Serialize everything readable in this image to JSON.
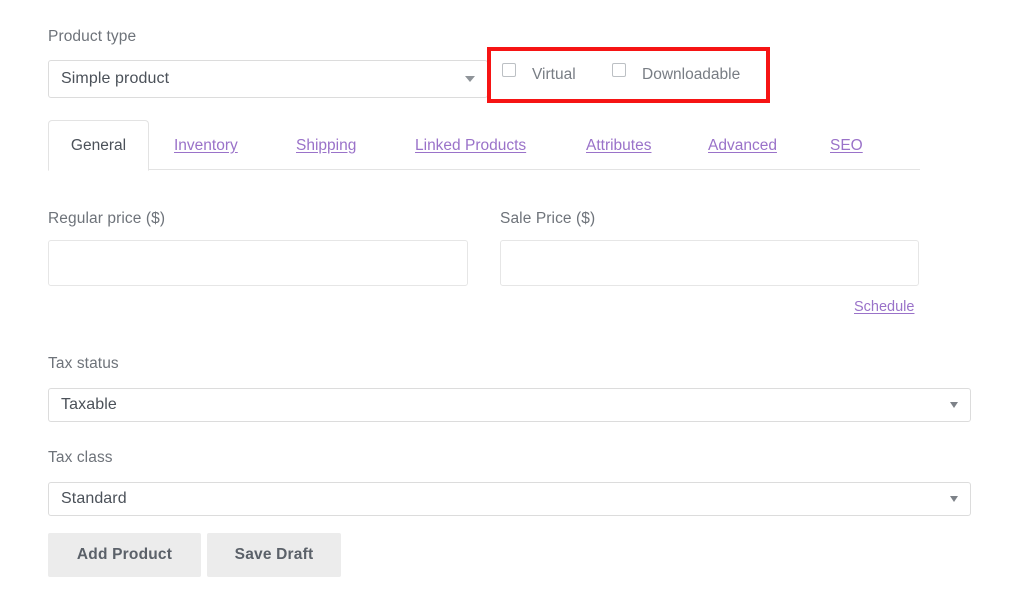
{
  "form": {
    "product_type": {
      "label": "Product type",
      "selected": "Simple product",
      "caret_icon": "chevron-down-icon"
    },
    "checkboxes": [
      {
        "id": "virtual",
        "label": "Virtual",
        "checked": false
      },
      {
        "id": "downloadable",
        "label": "Downloadable",
        "checked": false
      }
    ],
    "annotation": {
      "type": "highlight-rectangle",
      "color": "#f61414",
      "targets": [
        "Virtual",
        "Downloadable"
      ]
    }
  },
  "tabs": [
    {
      "label": "General",
      "active": true
    },
    {
      "label": "Inventory",
      "active": false
    },
    {
      "label": "Shipping",
      "active": false
    },
    {
      "label": "Linked Products",
      "active": false
    },
    {
      "label": "Attributes",
      "active": false
    },
    {
      "label": "Advanced",
      "active": false
    },
    {
      "label": "SEO",
      "active": false
    }
  ],
  "general_panel": {
    "regular_price": {
      "label": "Regular price ($)",
      "value": "",
      "placeholder": ""
    },
    "sale_price": {
      "label": "Sale Price ($)",
      "value": "",
      "placeholder": ""
    },
    "schedule_link": "Schedule",
    "tax_status": {
      "label": "Tax status",
      "selected": "Taxable"
    },
    "tax_class": {
      "label": "Tax class",
      "selected": "Standard"
    }
  },
  "actions": {
    "add_product": "Add Product",
    "save_draft": "Save Draft"
  },
  "colors": {
    "link_purple": "#9a72c9",
    "annotation_red": "#f61414",
    "label_gray": "#6e737a",
    "button_bg": "#ececec"
  }
}
